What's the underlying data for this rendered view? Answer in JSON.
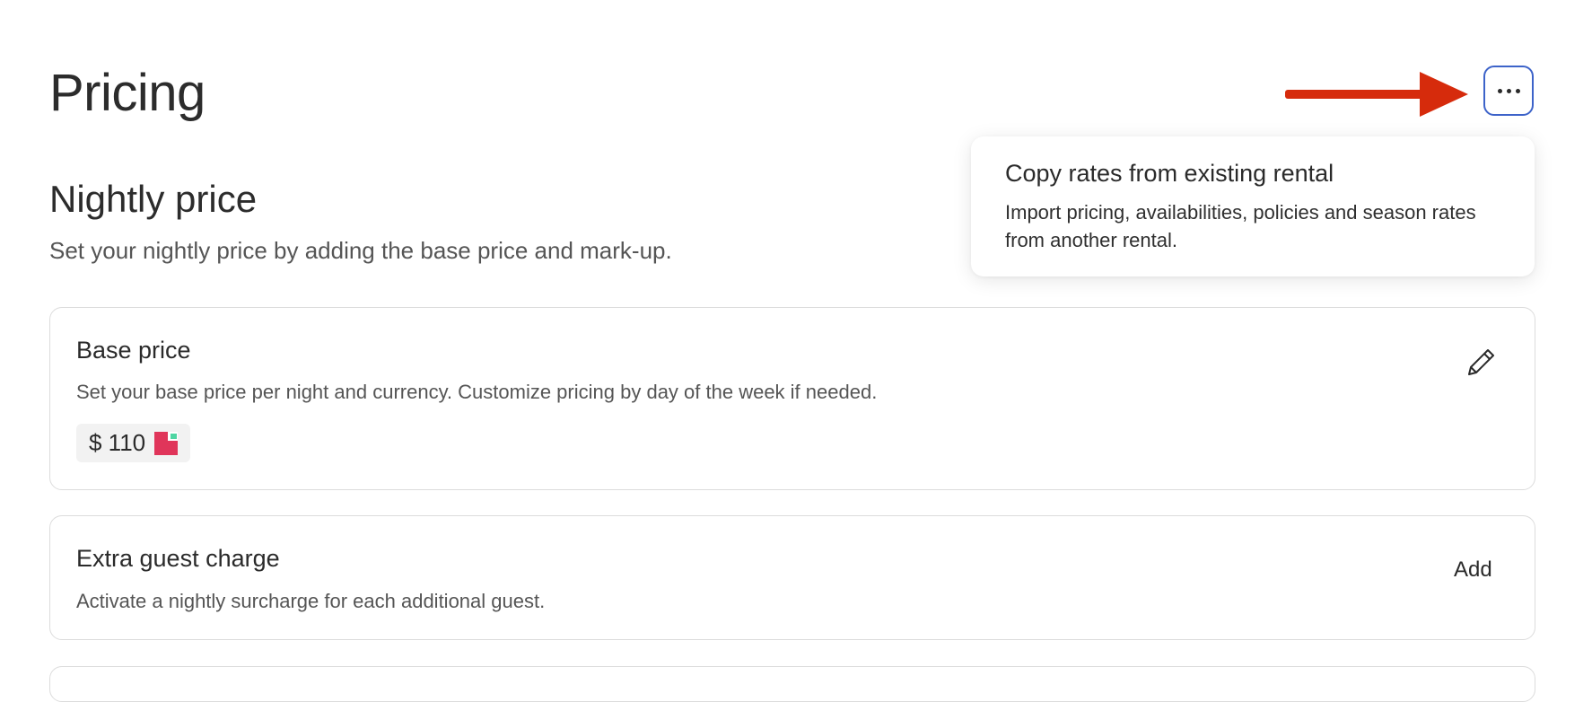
{
  "page": {
    "title": "Pricing"
  },
  "section": {
    "title": "Nightly price",
    "description": "Set your nightly price by adding the base price and mark-up."
  },
  "more_menu": {
    "button_icon": "more-horizontal-icon",
    "items": [
      {
        "title": "Copy rates from existing rental",
        "description": "Import pricing, availabilities, policies and season rates from another rental."
      }
    ]
  },
  "annotation": {
    "arrow_color": "#d62b0c"
  },
  "cards": {
    "base_price": {
      "title": "Base price",
      "description": "Set your base price per night and currency. Customize pricing by day of the week if needed.",
      "price": "$ 110",
      "edit_icon": "pencil-icon"
    },
    "extra_guest": {
      "title": "Extra guest charge",
      "description": "Activate a nightly surcharge for each additional guest.",
      "action_label": "Add"
    }
  },
  "colors": {
    "focus_border": "#3d63c9",
    "card_border": "#dcdcdc"
  }
}
